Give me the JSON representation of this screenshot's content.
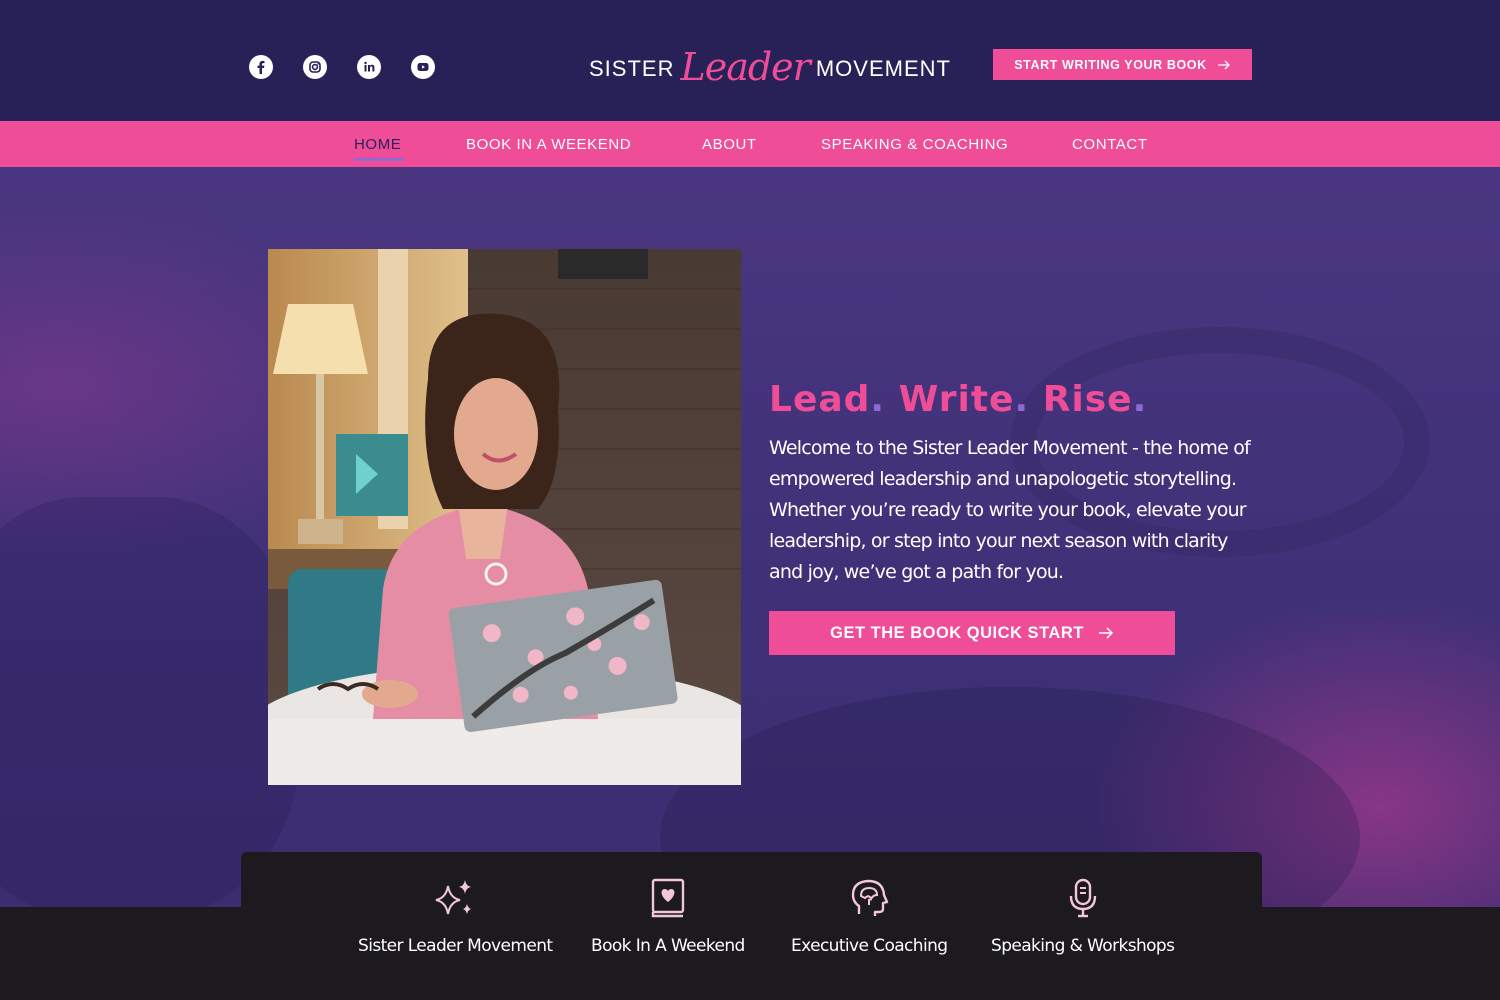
{
  "header": {
    "socials": [
      {
        "icon": "facebook-icon"
      },
      {
        "icon": "instagram-icon"
      },
      {
        "icon": "linkedin-icon"
      },
      {
        "icon": "youtube-icon"
      }
    ],
    "logo": {
      "part1": "SISTER",
      "script": "Leader",
      "part2": "MOVEMENT"
    },
    "cta_label": "START WRITING YOUR BOOK"
  },
  "nav": {
    "items": [
      "HOME",
      "BOOK IN A WEEKEND",
      "ABOUT",
      "SPEAKING & COACHING",
      "CONTACT"
    ],
    "active": "HOME"
  },
  "hero": {
    "headline_words": [
      "Lead",
      "Write",
      "Rise"
    ],
    "intro": "Welcome to the Sister Leader Movement - the home of empowered leadership and unapologetic storytelling. Whether you’re ready to write your book, elevate your leadership, or step into your next season with clarity and joy, we’ve got a path for you.",
    "cta_label": "GET THE BOOK QUICK START"
  },
  "features": [
    {
      "label": "Sister Leader Movement",
      "icon": "sparkles-icon"
    },
    {
      "label": "Book In A Weekend",
      "icon": "book-heart-icon"
    },
    {
      "label": "Executive Coaching",
      "icon": "head-mind-icon"
    },
    {
      "label": "Speaking & Workshops",
      "icon": "microphone-icon"
    }
  ],
  "colors": {
    "header_bg": "#272157",
    "accent_pink": "#f04d98",
    "accent_purple": "#8c6bd6",
    "features_bg": "#1c1a1e"
  }
}
